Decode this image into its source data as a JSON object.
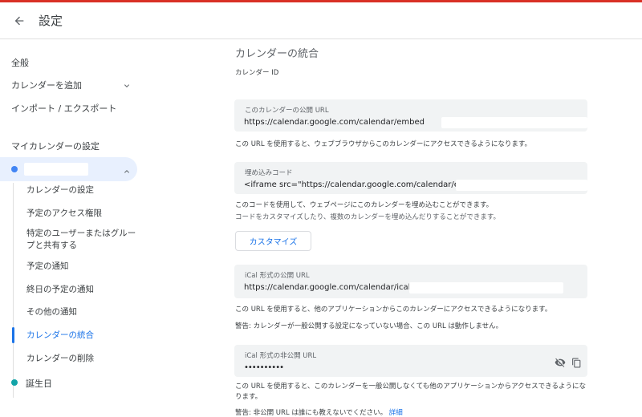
{
  "header": {
    "title": "設定",
    "back_icon": "arrow-back-icon"
  },
  "sidebar": {
    "general": "全般",
    "add_calendar": "カレンダーを追加",
    "import_export": "インポート / エクスポート",
    "my_calendars_heading": "マイカレンダーの設定",
    "sub_items": [
      {
        "label": "カレンダーの設定"
      },
      {
        "label": "予定のアクセス権限"
      },
      {
        "label": "特定のユーザーまたはグループと共有する"
      },
      {
        "label": "予定の通知"
      },
      {
        "label": "終日の予定の通知"
      },
      {
        "label": "その他の通知"
      },
      {
        "label": "カレンダーの統合",
        "active": true
      },
      {
        "label": "カレンダーの削除"
      }
    ],
    "birthday": "誕生日",
    "calendar_color": "#4285f4",
    "birthday_color": "#12a4a8"
  },
  "main": {
    "section_title": "カレンダーの統合",
    "calendar_id_label": "カレンダー ID",
    "public_url": {
      "label": "このカレンダーの公開 URL",
      "value": "https://calendar.google.com/calendar/embed"
    },
    "public_url_help": "この URL を使用すると、ウェブブラウザからこのカレンダーにアクセスできるようになります。",
    "embed_code": {
      "label": "埋め込みコード",
      "value": "<iframe src=\"https://calendar.google.com/calendar/embed"
    },
    "embed_help_1": "このコードを使用して、ウェブページにこのカレンダーを埋め込むことができます。",
    "embed_help_2": "コードをカスタマイズしたり、複数のカレンダーを埋め込んだりすることができます。",
    "customize_button": "カスタマイズ",
    "ical_public": {
      "label": "iCal 形式の公開 URL",
      "value": "https://calendar.google.com/calendar/ical/"
    },
    "ical_public_help": "この URL を使用すると、他のアプリケーションからこのカレンダーにアクセスできるようになります。",
    "ical_public_warning": "警告: カレンダーが一般公開する設定になっていない場合、この URL は動作しません。",
    "ical_private": {
      "label": "iCal 形式の非公開 URL",
      "value": "••••••••••"
    },
    "ical_private_help": "この URL を使用すると、このカレンダーを一般公開しなくても他のアプリケーションからアクセスできるようになります。",
    "ical_private_warning": "警告: 非公開 URL は誰にも教えないでください。",
    "details_link": "詳細"
  },
  "accent_color": "#1a73e8"
}
